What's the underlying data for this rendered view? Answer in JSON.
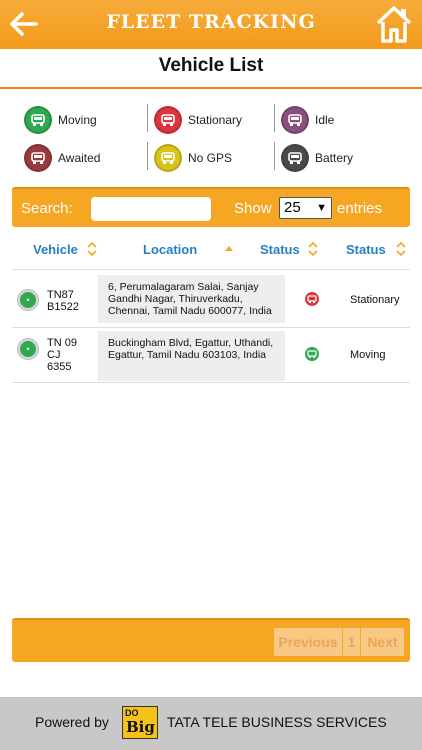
{
  "header": {
    "title": "FLEET TRACKING",
    "back_icon": "back-arrow-icon",
    "home_icon": "home-icon"
  },
  "page": {
    "title": "Vehicle List"
  },
  "legend": [
    {
      "label": "Moving",
      "color": "#2fa84f"
    },
    {
      "label": "Stationary",
      "color": "#d9363e"
    },
    {
      "label": "Idle",
      "color": "#8a4f7d"
    },
    {
      "label": "Awaited",
      "color": "#9a3b3b"
    },
    {
      "label": "No GPS",
      "color": "#d9c21a"
    },
    {
      "label": "Battery",
      "color": "#4a4a4a"
    }
  ],
  "search": {
    "label": "Search:",
    "value": "",
    "show_label": "Show",
    "entries_value": "25",
    "entries_label": "entries"
  },
  "table": {
    "columns": [
      "Vehicle",
      "Location",
      "Status",
      "Status"
    ],
    "rows": [
      {
        "vehicle": [
          "TN87",
          "B1522"
        ],
        "location": "6, Perumalagaram Salai, Sanjay Gandhi Nagar, Thiruverkadu, Chennai, Tamil Nadu 600077, India",
        "status_icon_color": "#d9363e",
        "status": "Stationary"
      },
      {
        "vehicle": [
          "TN 09",
          "CJ",
          "6355"
        ],
        "location": "Buckingham Blvd, Egattur, Uthandi, Egattur, Tamil Nadu 603103, India",
        "status_icon_color": "#2fa84f",
        "status": "Moving"
      }
    ]
  },
  "pager": {
    "previous": "Previous",
    "page": "1",
    "next": "Next"
  },
  "footer": {
    "powered_by": "Powered by",
    "logo_top": "DO",
    "logo_bottom": "Big",
    "company": "TATA TELE BUSINESS SERVICES"
  },
  "colors": {
    "accent": "#f5a623",
    "rule": "#ff7a1a",
    "header_text": "#2a7fc0"
  }
}
